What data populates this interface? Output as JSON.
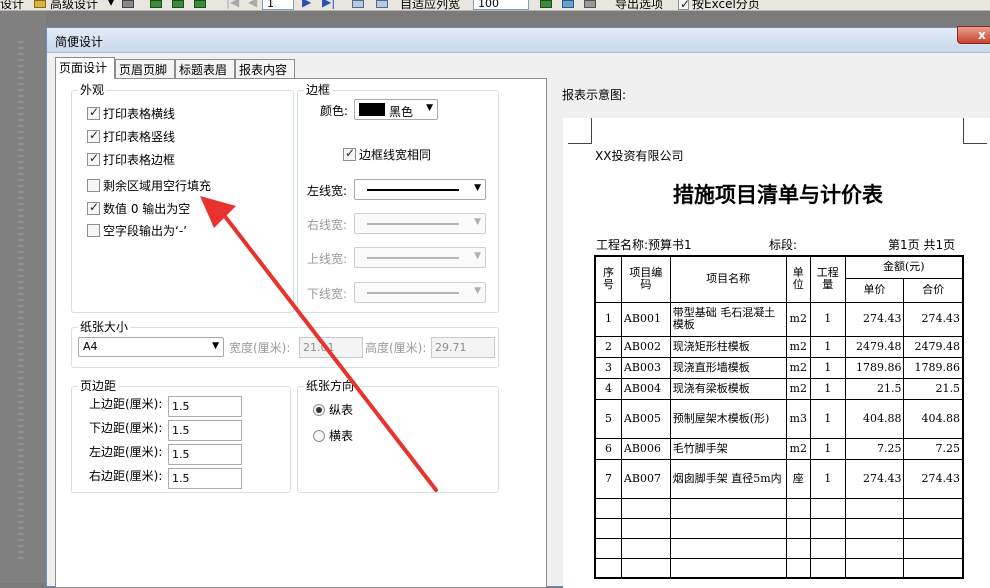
{
  "toolbar": {
    "design_label": "设计",
    "advanced_design_label": "高级设计",
    "page_field": "1",
    "autofit_label": "自适应列宽",
    "zoom_field": "100",
    "export_option_label": "导出选项",
    "excel_pages_label": "按Excel分页"
  },
  "dialog": {
    "title": "简便设计",
    "close_label": "x",
    "tabs": [
      "页面设计",
      "页眉页脚",
      "标题表眉",
      "报表内容"
    ]
  },
  "appearance": {
    "group_label": "外观",
    "options": [
      {
        "label": "打印表格横线",
        "checked": true
      },
      {
        "label": "打印表格竖线",
        "checked": true
      },
      {
        "label": "打印表格边框",
        "checked": true
      },
      {
        "label": "剩余区域用空行填充",
        "checked": false
      },
      {
        "label": "数值 0 输出为空",
        "checked": true
      },
      {
        "label": "空字段输出为‘-’",
        "checked": false
      }
    ]
  },
  "border": {
    "group_label": "边框",
    "color_label": "颜色:",
    "color_value": "黑色",
    "color_swatch": "#000000",
    "same_width_label": "边框线宽相同",
    "same_width_checked": true,
    "left_label": "左线宽:",
    "right_label": "右线宽:",
    "top_label": "上线宽:",
    "bottom_label": "下线宽:"
  },
  "paper": {
    "group_label": "纸张大小",
    "size_value": "A4",
    "width_label": "宽度(厘米):",
    "width_value": "21.01",
    "height_label": "高度(厘米):",
    "height_value": "29.71"
  },
  "margins": {
    "group_label": "页边距",
    "top_label": "上边距(厘米):",
    "top_value": "1.5",
    "bottom_label": "下边距(厘米):",
    "bottom_value": "1.5",
    "left_label": "左边距(厘米):",
    "left_value": "1.5",
    "right_label": "右边距(厘米):",
    "right_value": "1.5"
  },
  "orientation": {
    "group_label": "纸张方向",
    "portrait_label": "纵表",
    "landscape_label": "横表",
    "selected": "portrait"
  },
  "preview": {
    "label": "报表示意图:",
    "company": "XX投资有限公司",
    "title": "措施项目清单与计价表",
    "project_label": "工程名称:预算书1",
    "section_label": "标段:",
    "page_label": "第1页 共1页",
    "headers": {
      "seq": "序号",
      "code": "项目编码",
      "name": "项目名称",
      "unit": "单位",
      "qty": "工程量",
      "amount": "金额(元)",
      "unit_price": "单价",
      "total": "合价"
    },
    "rows": [
      {
        "seq": "1",
        "code": "AB001",
        "name": "带型基础 毛石混凝土模板",
        "unit": "m2",
        "qty": "1",
        "price": "274.43",
        "total": "274.43"
      },
      {
        "seq": "2",
        "code": "AB002",
        "name": "现浇矩形柱模板",
        "unit": "m2",
        "qty": "1",
        "price": "2479.48",
        "total": "2479.48"
      },
      {
        "seq": "3",
        "code": "AB003",
        "name": "现浇直形墙模板",
        "unit": "m2",
        "qty": "1",
        "price": "1789.86",
        "total": "1789.86"
      },
      {
        "seq": "4",
        "code": "AB004",
        "name": "现浇有梁板模板",
        "unit": "m2",
        "qty": "1",
        "price": "21.5",
        "total": "21.5"
      },
      {
        "seq": "5",
        "code": "AB005",
        "name": "预制屋架木模板(形)",
        "unit": "m3",
        "qty": "1",
        "price": "404.88",
        "total": "404.88"
      },
      {
        "seq": "6",
        "code": "AB006",
        "name": "毛竹脚手架",
        "unit": "m2",
        "qty": "1",
        "price": "7.25",
        "total": "7.25"
      },
      {
        "seq": "7",
        "code": "AB007",
        "name": "烟囱脚手架 直径5m内",
        "unit": "座",
        "qty": "1",
        "price": "274.43",
        "total": "274.43"
      }
    ]
  },
  "annotation_color": "#e8322d"
}
